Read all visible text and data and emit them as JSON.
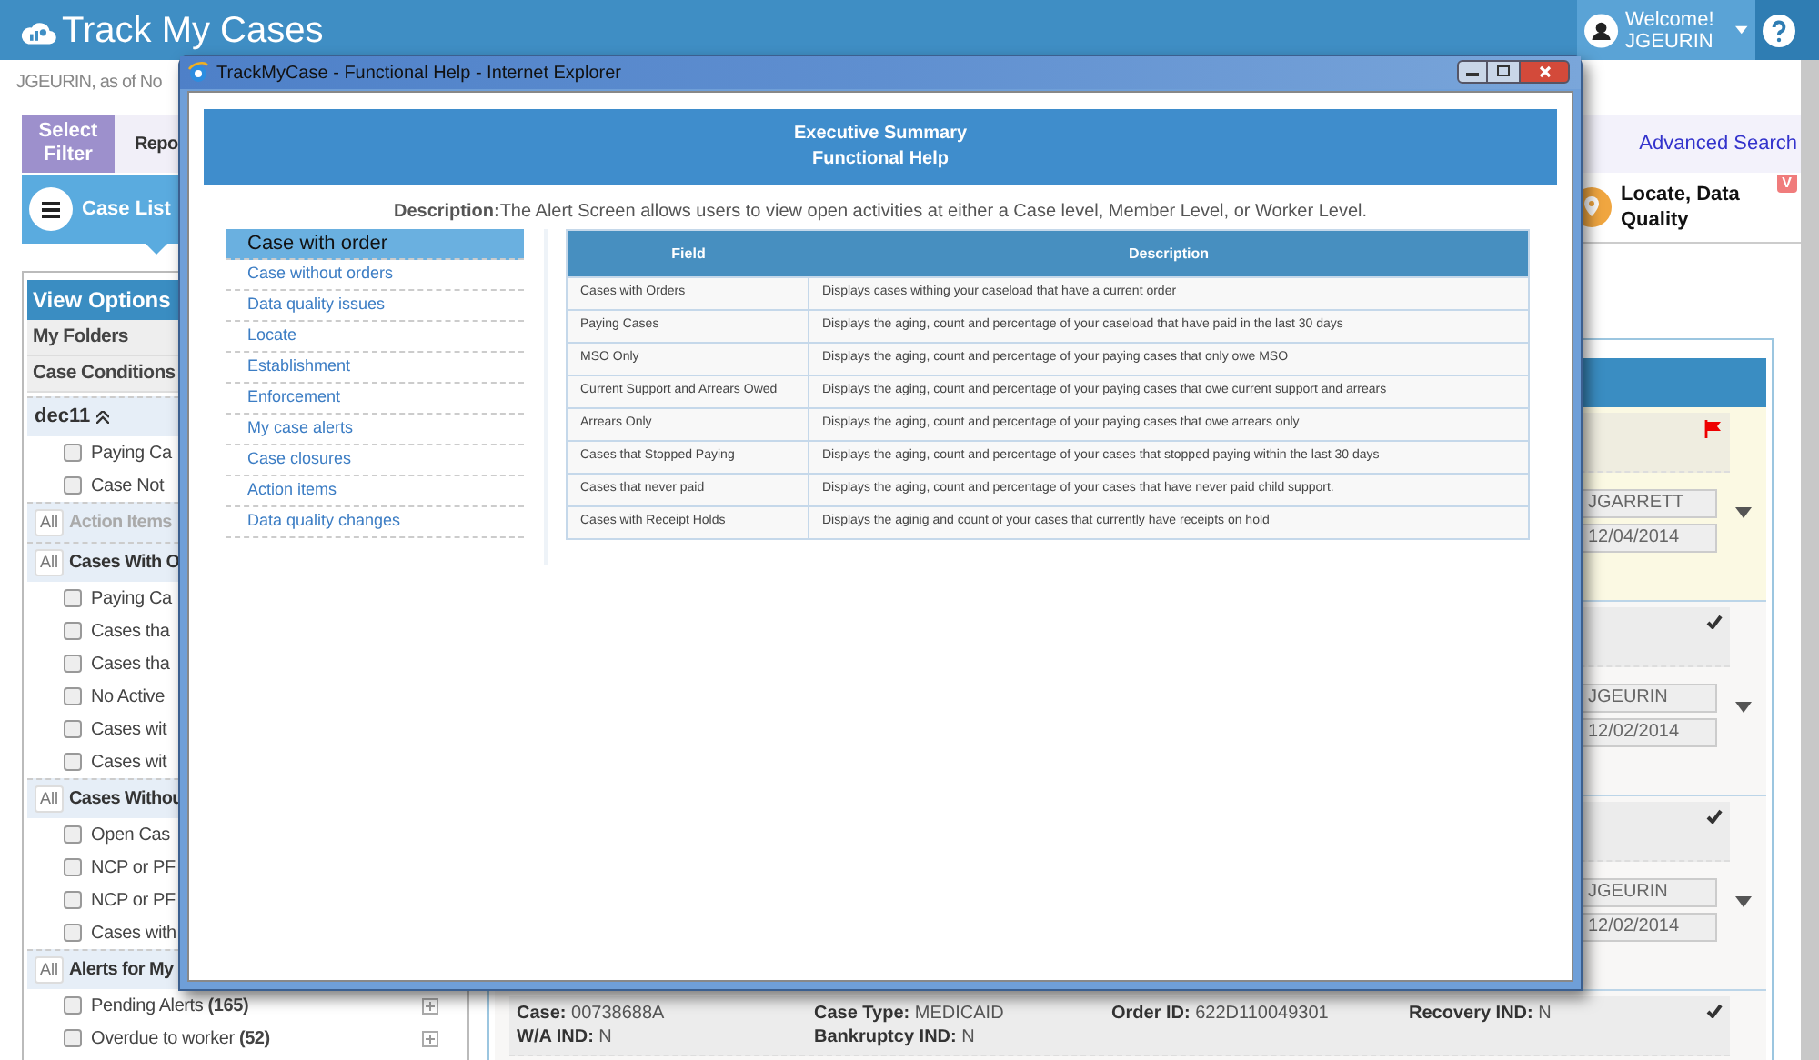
{
  "app": {
    "title": "Track My Cases",
    "greeting": "Welcome!",
    "user": "JGEURIN"
  },
  "as_of": "JGEURIN, as of No",
  "filter_tabs": [
    {
      "label": "Select Filter",
      "selected": true
    },
    {
      "label": "Repo",
      "selected": false
    }
  ],
  "case_list": "Case List",
  "advanced_search": "Advanced Search",
  "locate": {
    "label": "Locate, Data Quality",
    "badge": "V"
  },
  "sidebar": {
    "sections": [
      {
        "kind": "header",
        "label": "View Options"
      },
      {
        "kind": "folder",
        "label": "My Folders"
      },
      {
        "kind": "folder",
        "label": "Case Conditions"
      }
    ],
    "groups": [
      {
        "kind": "collapsible",
        "label": "dec11",
        "expanded": true,
        "items": [
          {
            "label": "Paying Ca",
            "checked": false,
            "expandable": false
          },
          {
            "label": "Case Not",
            "checked": false,
            "expandable": false
          }
        ]
      },
      {
        "kind": "all",
        "button": "All",
        "label": "Action Items",
        "disabled": true
      },
      {
        "kind": "all",
        "button": "All",
        "label": "Cases With O",
        "disabled": false,
        "items": [
          {
            "label": "Paying Ca",
            "checked": false,
            "expandable": false
          },
          {
            "label": "Cases tha",
            "checked": false,
            "expandable": false
          },
          {
            "label": "Cases tha",
            "checked": false,
            "expandable": false
          },
          {
            "label": "No Active",
            "checked": false,
            "expandable": false
          },
          {
            "label": "Cases wit",
            "checked": false,
            "expandable": false
          },
          {
            "label": "Cases wit",
            "checked": false,
            "expandable": false
          }
        ]
      },
      {
        "kind": "all",
        "button": "All",
        "label": "Cases Withou",
        "disabled": false,
        "items": [
          {
            "label": "Open Cas",
            "checked": false,
            "expandable": false
          },
          {
            "label": "NCP or PF",
            "checked": false,
            "expandable": false
          },
          {
            "label": "NCP or PF",
            "checked": false,
            "expandable": false
          },
          {
            "label": "Cases with",
            "checked": false,
            "expandable": false
          }
        ]
      },
      {
        "kind": "all",
        "button": "All",
        "label": "Alerts for My",
        "disabled": false,
        "items": [
          {
            "label": "Pending Alerts **(165)**",
            "checked": false,
            "expandable": true
          },
          {
            "label": "Overdue to worker **(52)**",
            "checked": false,
            "expandable": true
          }
        ]
      }
    ]
  },
  "cards": [
    {
      "kind": "summary",
      "highlighted": true,
      "flagged": true,
      "worker": "JGARRETT",
      "date": "12/04/2014"
    },
    {
      "kind": "summary",
      "highlighted": false,
      "flagged": false,
      "worker": "JGEURIN",
      "date": "12/02/2014"
    },
    {
      "kind": "summary",
      "highlighted": false,
      "flagged": false,
      "worker": "JGEURIN",
      "date": "12/02/2014"
    },
    {
      "kind": "detail",
      "highlighted": false,
      "flagged": false,
      "fields": [
        {
          "label": "Case:",
          "value": "00738688A"
        },
        {
          "label": "Case Type:",
          "value": "MEDICAID"
        },
        {
          "label": "Order ID:",
          "value": "622D110049301"
        },
        {
          "label": "Recovery IND:",
          "value": "N"
        },
        {
          "label": "W/A IND:",
          "value": "N"
        },
        {
          "label": "Bankruptcy IND:",
          "value": "N"
        }
      ]
    }
  ],
  "popup": {
    "title": "TrackMyCase - Functional Help - Internet Explorer",
    "heading": [
      "Executive Summary",
      "Functional Help"
    ],
    "description": "**Description:**The Alert Screen allows users to view open activities at either a Case level, Member Level, or Worker Level.",
    "nav": [
      {
        "label": "Case with order",
        "selected": true
      },
      {
        "label": "Case without orders",
        "selected": false
      },
      {
        "label": "Data quality issues",
        "selected": false
      },
      {
        "label": "Locate",
        "selected": false
      },
      {
        "label": "Establishment",
        "selected": false
      },
      {
        "label": "Enforcement",
        "selected": false
      },
      {
        "label": "My case alerts",
        "selected": false
      },
      {
        "label": "Case closures",
        "selected": false
      },
      {
        "label": "Action items",
        "selected": false
      },
      {
        "label": "Data quality changes",
        "selected": false
      }
    ],
    "table": {
      "columns": [
        "Field",
        "Description"
      ],
      "rows": [
        [
          "Cases with Orders",
          "Displays cases withing your caseload that have a current order"
        ],
        [
          "Paying Cases",
          "Displays the aging, count and percentage of your caseload that have paid in the last 30 days"
        ],
        [
          "MSO Only",
          "Displays the aging, count and percentage of your paying cases that only owe MSO"
        ],
        [
          "Current Support and Arrears Owed",
          "Displays the aging, count and percentage of your paying cases that owe current support and arrears"
        ],
        [
          "Arrears Only",
          "Displays the aging, count and percentage of your paying cases that owe arrears only"
        ],
        [
          "Cases that Stopped Paying",
          "Displays the aging, count and percentage of your cases that stopped paying within the last 30 days"
        ],
        [
          "Cases that never paid",
          "Displays the aging, count and percentage of your cases that have never paid child support."
        ],
        [
          "Cases with Receipt Holds",
          "Displays the aginig and count of your cases that currently have receipts on hold"
        ]
      ]
    }
  }
}
